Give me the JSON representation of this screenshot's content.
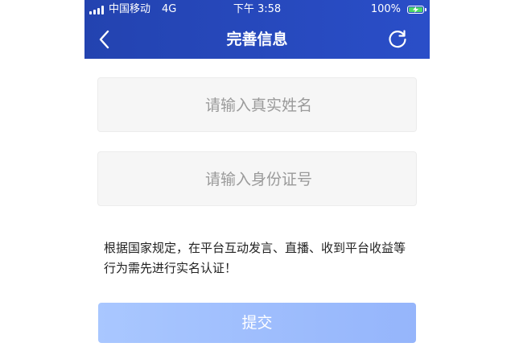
{
  "status_bar": {
    "carrier": "中国移动",
    "network": "4G",
    "time": "下午 3:58",
    "battery_percent": "100%",
    "icons": [
      "signal-icon",
      "battery-charging-icon"
    ]
  },
  "nav": {
    "title": "完善信息",
    "icons": [
      "back-arrow-icon",
      "refresh-icon"
    ]
  },
  "form": {
    "name_placeholder": "请输入真实姓名",
    "id_placeholder": "请输入身份证号",
    "notice": "根据国家规定，在平台互动发言、直播、收到平台收益等行为需先进行实名认证！",
    "submit_label": "提交"
  },
  "colors": {
    "header": "#2548bc",
    "submit_button": "#a3c0fe",
    "input_bg": "#f6f6f6"
  }
}
